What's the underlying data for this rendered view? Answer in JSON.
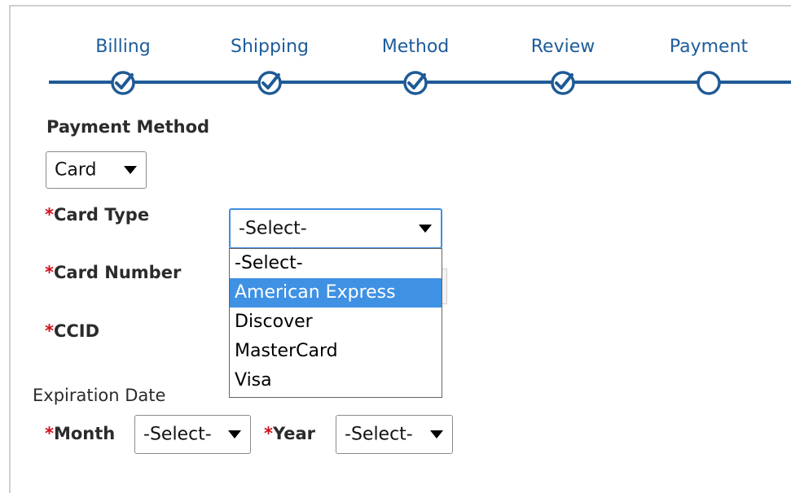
{
  "stepper": {
    "steps": [
      {
        "label": "Billing",
        "state": "complete"
      },
      {
        "label": "Shipping",
        "state": "complete"
      },
      {
        "label": "Method",
        "state": "complete"
      },
      {
        "label": "Review",
        "state": "complete"
      },
      {
        "label": "Payment",
        "state": "current"
      }
    ]
  },
  "form": {
    "payment_method_label": "Payment Method",
    "payment_method_value": "Card",
    "required_mark": "*",
    "card_type_label": "Card Type",
    "card_type_value": "-Select-",
    "card_type_options": [
      "-Select-",
      "American Express",
      "Discover",
      "MasterCard",
      "Visa"
    ],
    "card_type_highlighted": "American Express",
    "card_number_label": "Card Number",
    "ccid_label": "CCID",
    "expiration_label": "Expiration Date",
    "month_label": "Month",
    "month_value": "-Select-",
    "year_label": "Year",
    "year_value": "-Select-"
  },
  "colors": {
    "accent": "#1f5a96",
    "step_text": "#1d5c9b",
    "required": "#d0101b",
    "highlight": "#3f91e4"
  },
  "icons": [
    "check-circle-icon",
    "empty-circle-icon",
    "dropdown-arrow-icon"
  ]
}
